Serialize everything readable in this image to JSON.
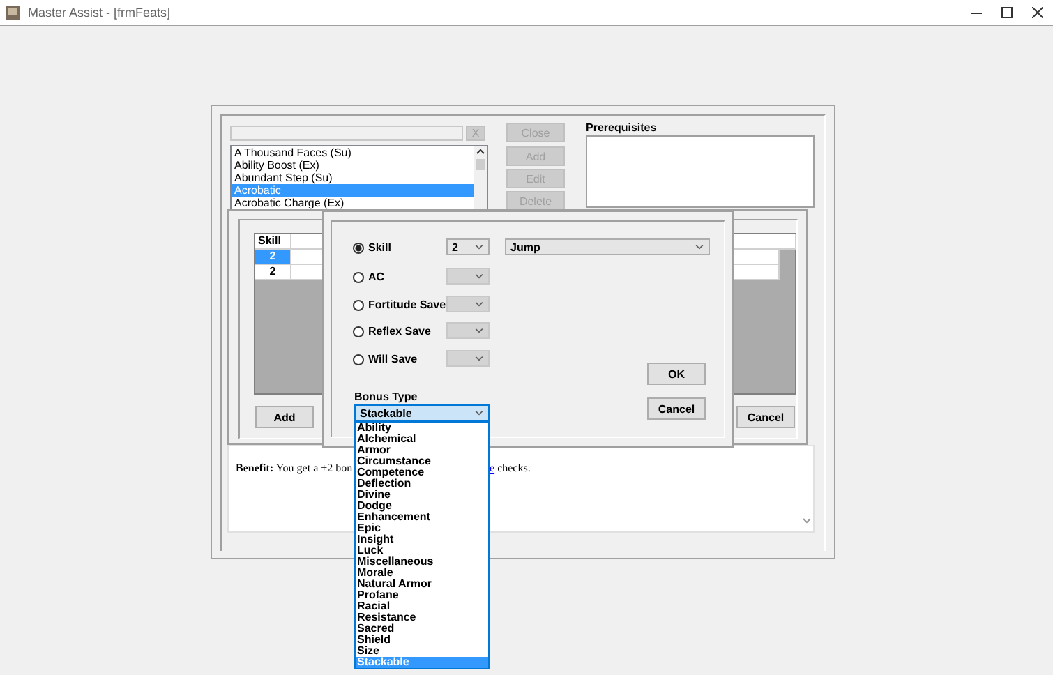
{
  "window": {
    "title": "Master Assist - [frmFeats]"
  },
  "feats_form": {
    "clear_button": {
      "label": "X",
      "disabled": true
    },
    "feat_list": [
      {
        "label": "A Thousand Faces (Su)",
        "selected": false
      },
      {
        "label": "Ability Boost (Ex)",
        "selected": false
      },
      {
        "label": "Abundant Step (Su)",
        "selected": false
      },
      {
        "label": "Acrobatic",
        "selected": true
      },
      {
        "label": "Acrobatic Charge (Ex)",
        "selected": false
      }
    ],
    "buttons": [
      {
        "label": "Close",
        "disabled": true
      },
      {
        "label": "Add",
        "disabled": true
      },
      {
        "label": "Edit",
        "disabled": true
      },
      {
        "label": "Delete",
        "disabled": true
      }
    ],
    "prerequisites": {
      "label": "Prerequisites"
    },
    "benefit": {
      "text_before": "**Benefit:** You get a +2 bon",
      "link": "e",
      "text_after": " checks."
    }
  },
  "bonus_panel": {
    "grid": {
      "columns": [
        "Skill"
      ],
      "rows": [
        {
          "cells": [
            "2"
          ],
          "selected": true
        },
        {
          "cells": [
            "2"
          ],
          "selected": false
        }
      ]
    },
    "buttons": [
      "Add",
      "Cancel"
    ]
  },
  "bonus_dialog": {
    "targets": [
      {
        "label": "Skill",
        "selected": true,
        "value": "2",
        "detail": "Jump"
      },
      {
        "label": "AC",
        "selected": false
      },
      {
        "label": "Fortitude Save",
        "selected": false
      },
      {
        "label": "Reflex Save",
        "selected": false
      },
      {
        "label": "Will Save",
        "selected": false
      }
    ],
    "bonus_type": {
      "label": "Bonus Type",
      "value": "Stackable",
      "options": [
        {
          "label": "Ability",
          "selected": false
        },
        {
          "label": "Alchemical",
          "selected": false
        },
        {
          "label": "Armor",
          "selected": false
        },
        {
          "label": "Circumstance",
          "selected": false
        },
        {
          "label": "Competence",
          "selected": false
        },
        {
          "label": "Deflection",
          "selected": false
        },
        {
          "label": "Divine",
          "selected": false
        },
        {
          "label": "Dodge",
          "selected": false
        },
        {
          "label": "Enhancement",
          "selected": false
        },
        {
          "label": "Epic",
          "selected": false
        },
        {
          "label": "Insight",
          "selected": false
        },
        {
          "label": "Luck",
          "selected": false
        },
        {
          "label": "Miscellaneous",
          "selected": false
        },
        {
          "label": "Morale",
          "selected": false
        },
        {
          "label": "Natural Armor",
          "selected": false
        },
        {
          "label": "Profane",
          "selected": false
        },
        {
          "label": "Racial",
          "selected": false
        },
        {
          "label": "Resistance",
          "selected": false
        },
        {
          "label": "Sacred",
          "selected": false
        },
        {
          "label": "Shield",
          "selected": false
        },
        {
          "label": "Size",
          "selected": false
        },
        {
          "label": "Stackable",
          "selected": true
        }
      ]
    },
    "buttons": [
      "OK",
      "Cancel"
    ]
  }
}
